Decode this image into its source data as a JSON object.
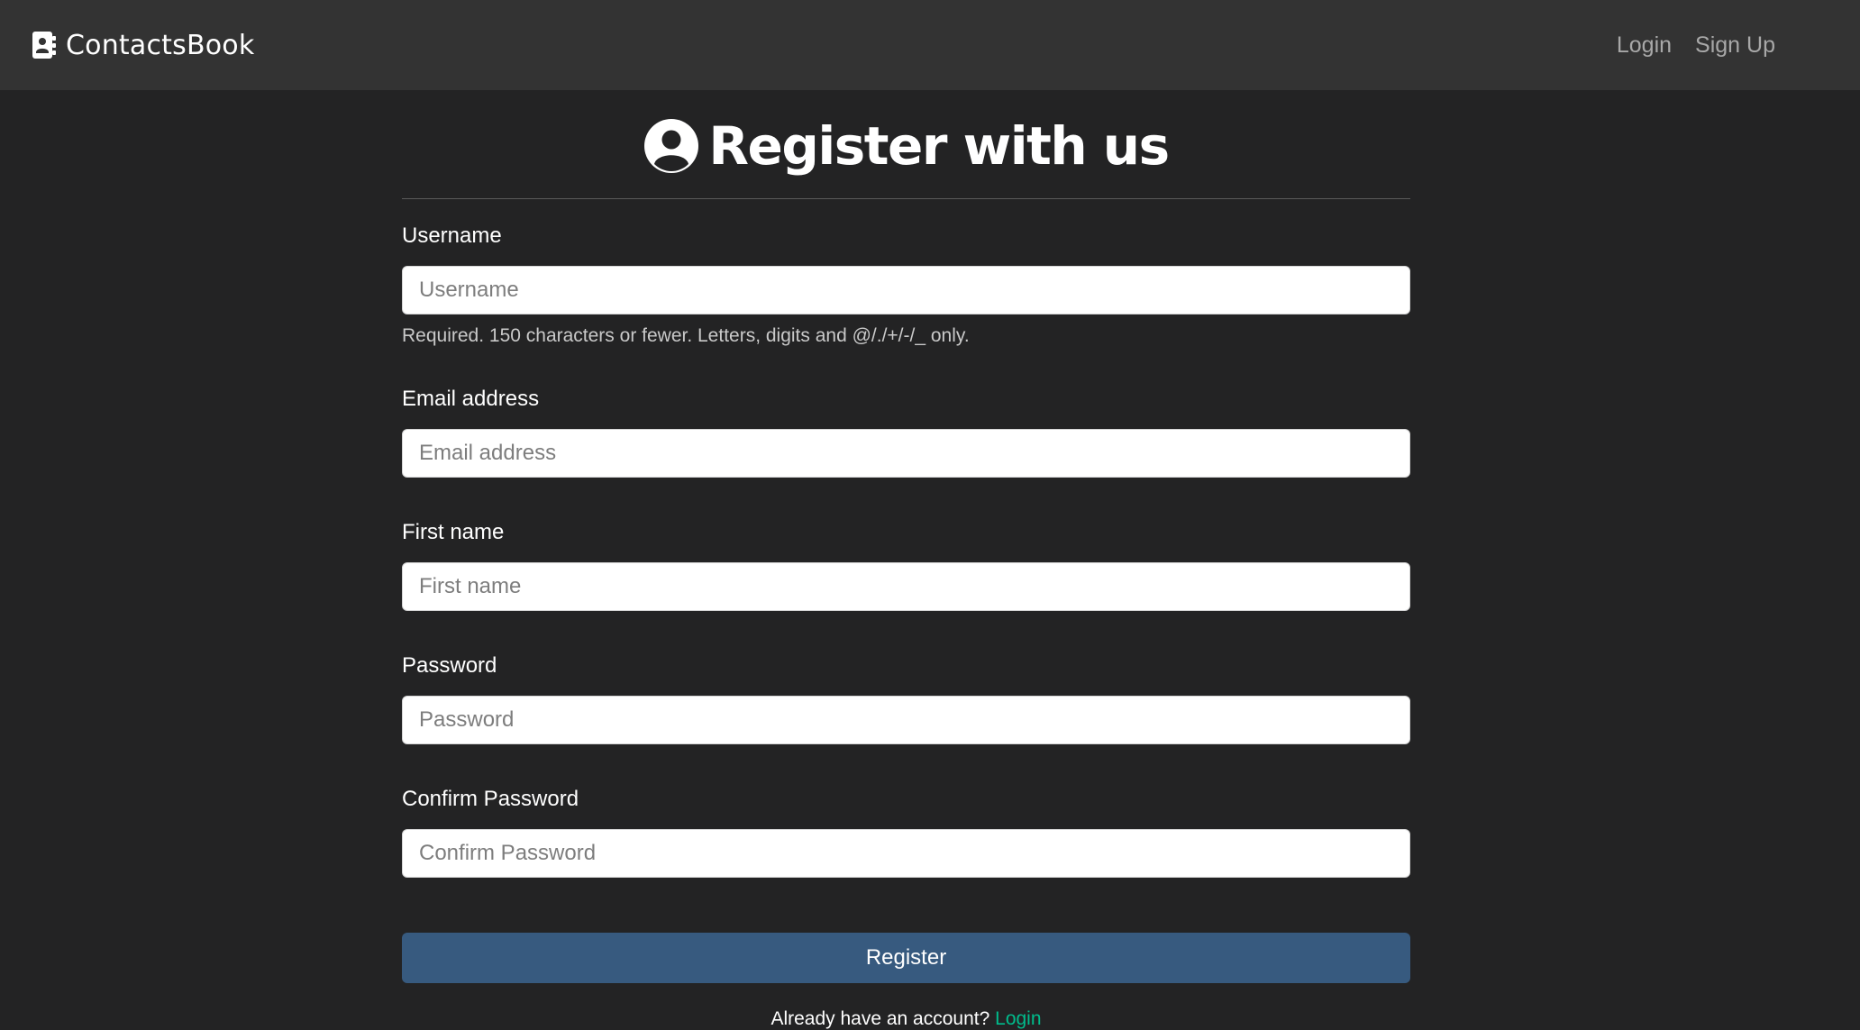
{
  "colors": {
    "navbar_bg": "#333333",
    "page_bg": "#232324",
    "primary_button": "#375a7f",
    "link_accent": "#00bc8c",
    "nav_link": "#a8a8a8"
  },
  "navbar": {
    "brand": {
      "icon": "address-book-icon",
      "label": "ContactsBook"
    },
    "links": [
      {
        "label": "Login"
      },
      {
        "label": "Sign Up"
      }
    ]
  },
  "page": {
    "icon": "user-circle-icon",
    "title": "Register with us"
  },
  "form": {
    "fields": [
      {
        "label": "Username",
        "placeholder": "Username",
        "value": "",
        "help": "Required. 150 characters or fewer. Letters, digits and @/./+/-/_ only."
      },
      {
        "label": "Email address",
        "placeholder": "Email address",
        "value": ""
      },
      {
        "label": "First name",
        "placeholder": "First name",
        "value": ""
      },
      {
        "label": "Password",
        "placeholder": "Password",
        "value": ""
      },
      {
        "label": "Confirm Password",
        "placeholder": "Confirm Password",
        "value": ""
      }
    ],
    "submit_label": "Register",
    "footer": {
      "text": "Already have an account?",
      "link_label": "Login"
    }
  }
}
